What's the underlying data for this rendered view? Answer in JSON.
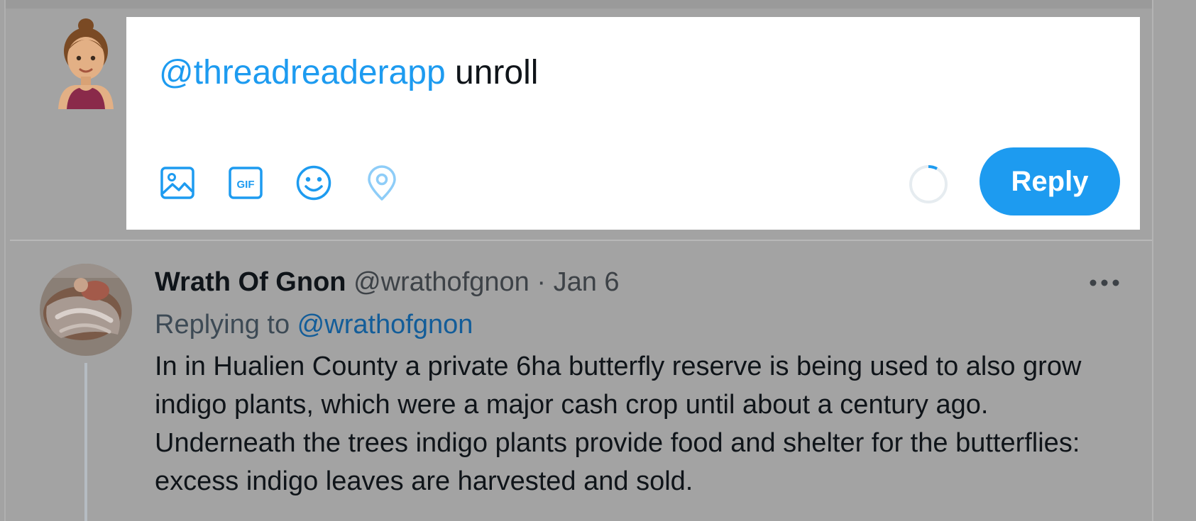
{
  "composer": {
    "mention": "@threadreaderapp",
    "text": " unroll",
    "reply_label": "Reply",
    "tools": [
      {
        "icon": "image-icon"
      },
      {
        "icon": "gif-icon",
        "label": "GIF"
      },
      {
        "icon": "emoji-icon"
      },
      {
        "icon": "location-icon"
      }
    ]
  },
  "tweet": {
    "author_name": "Wrath Of Gnon",
    "handle": "@wrathofgnon",
    "separator": " · ",
    "date": "Jan 6",
    "replying_prefix": "Replying to ",
    "replying_handle": "@wrathofgnon",
    "body": "In in Hualien County a private 6ha butterfly reserve is being used to also grow indigo plants, which were a major cash crop until about a century ago. Underneath the trees indigo plants provide food and shelter for the butterflies: excess indigo leaves are harvested and sold."
  },
  "colors": {
    "accent": "#1d9bf0",
    "overlay": "#a3a3a3",
    "mention_dimmed": "#135d99"
  }
}
